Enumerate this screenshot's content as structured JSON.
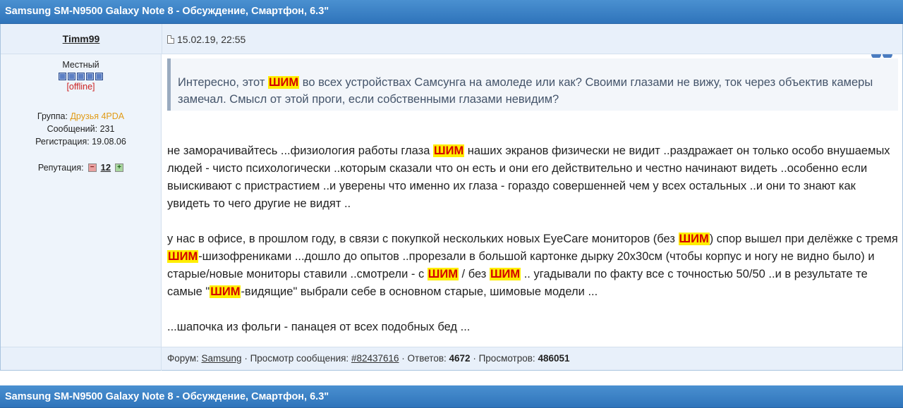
{
  "topic": {
    "title": "Samsung SM-N9500 Galaxy Note 8 - Обсуждение, Смартфон, 6.3\""
  },
  "post": {
    "author": "Timm99",
    "date": "15.02.19, 22:55",
    "rank": "Местный",
    "status": "[offline]",
    "group_label": "Группа:",
    "group_value": "Друзья 4PDA",
    "messages_label": "Сообщений:",
    "messages_value": "231",
    "registration_label": "Регистрация:",
    "registration_value": "19.08.06",
    "reputation_label": "Репутация:",
    "reputation_value": "12",
    "highlight": "ШИМ",
    "quote": {
      "t1": "Интересно, этот ",
      "t2": " во всех устройствах Самсунга на амоледе или как? Своими глазами не вижу, ток через объектив камеры замечал. Смысл от этой проги, если собственными глазами невидим?"
    },
    "p1": {
      "t1": "не заморачивайтесь ...физиология работы глаза ",
      "t2": " наших экранов физически не видит ..раздражает он только особо внушаемых людей - чисто психологически ..которым сказали что он есть и они его действительно и честно начинают видеть ..особенно если выискивают с пристрастием ..и уверены что именно их глаза - гораздо совершенней чем у всех остальных ..и они то знают как увидеть то чего другие не видят .."
    },
    "p2": {
      "t1": "у нас в офисе, в прошлом году, в связи с покупкой нескольких новых EyeCare мониторов (без ",
      "t2": ") спор вышел при делёжке с тремя ",
      "t3": "-шизофрениками ...дошло до опытов ..прорезали в большой картонке дырку 20х30см (чтобы корпус и ногу не видно было) и старые/новые мониторы ставили ..смотрели - с ",
      "t4": " / без ",
      "t5": " .. угадывали по факту все с точностью 50/50 ..и в результате те самые \"",
      "t6": "-видящие\" выбрали себе в основном старые, шимовые модели ..."
    },
    "p3": "...шапочка из фольги - панацея от всех подобных бед ..."
  },
  "footer": {
    "forum_label": "Форум:",
    "forum_value": "Samsung",
    "view_label": "Просмотр сообщения:",
    "view_value": "#82437616",
    "replies_label": "Ответов:",
    "replies_value": "4672",
    "views_label": "Просмотров:",
    "views_value": "486051"
  },
  "icons": {
    "date": "document-icon",
    "rep_down": "minus-icon",
    "rep_up": "plus-icon",
    "stars": "rank-star-icon"
  },
  "colors": {
    "header": "#2f74bb",
    "group": "#e19b17",
    "offline": "#cc2222",
    "highlight_bg": "#ffee00",
    "highlight_text": "#d40000"
  }
}
